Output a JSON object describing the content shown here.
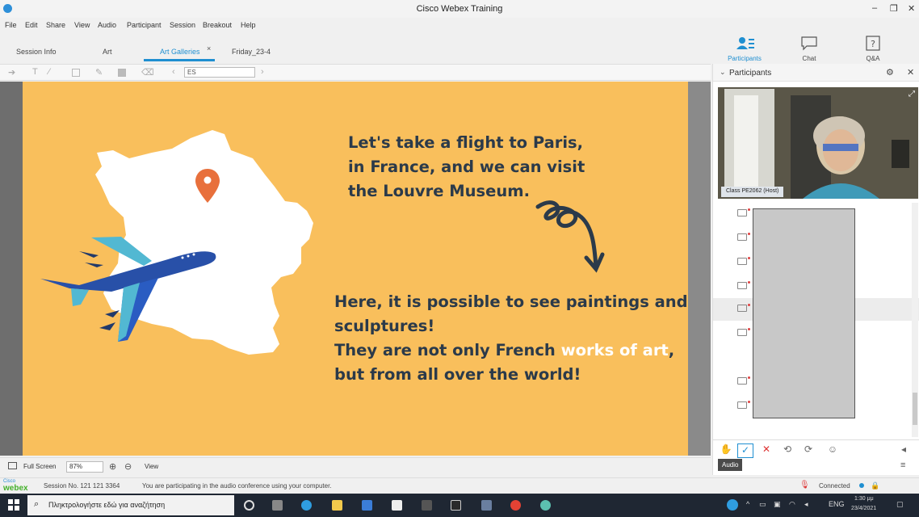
{
  "window": {
    "title": "Cisco Webex Training",
    "controls": [
      "–",
      "❐",
      "✕"
    ]
  },
  "menu": [
    "File",
    "Edit",
    "Share",
    "View",
    "Audio",
    "Participant",
    "Session",
    "Breakout",
    "Help"
  ],
  "tabs": [
    {
      "label": "Session Info",
      "active": false
    },
    {
      "label": "Art",
      "active": false
    },
    {
      "label": "Art Galleries",
      "active": true
    },
    {
      "label": "Friday_23-4",
      "active": false
    }
  ],
  "panel_buttons": [
    {
      "label": "Participants",
      "icon": "participants-icon",
      "active": true
    },
    {
      "label": "Chat",
      "icon": "chat-icon",
      "active": false
    },
    {
      "label": "Q&A",
      "icon": "qa-icon",
      "active": false
    }
  ],
  "toolbar": {
    "page_select": "ES"
  },
  "slide": {
    "bg": "#f9bf5c",
    "line1": "Let's take a flight to Paris,",
    "line2": "in France, and we can visit",
    "line3": "the Louvre Museum.",
    "para1": "Here, it is possible to see paintings and",
    "para2": "sculptures!",
    "para3_pre": "They are not only French ",
    "para3_hl": "works of art",
    "para3_post": ",",
    "para4": "but from all over the world!"
  },
  "bottombar": {
    "fullscreen": "Full Screen",
    "zoom": "87%",
    "view": "View"
  },
  "status": {
    "brand_top": "Cisco",
    "brand": "webex",
    "session": "Session No. 121 121 3364",
    "message": "You are participating in the audio conference using your computer.",
    "connected": "Connected"
  },
  "participants": {
    "title": "Participants",
    "host_name": "Class PE2062 (Host)",
    "audio_tip": "Audio"
  },
  "taskbar": {
    "search_placeholder": "Πληκτρολογήστε εδώ για αναζήτηση",
    "lang": "ENG",
    "time": "1:30 μμ",
    "date": "23/4/2021"
  }
}
